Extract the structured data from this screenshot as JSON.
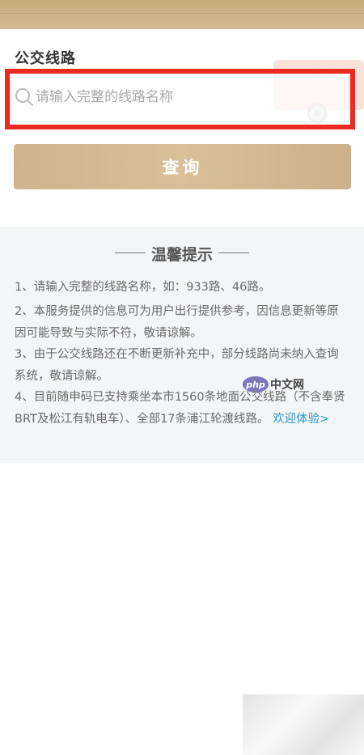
{
  "section": {
    "title": "公交线路"
  },
  "search": {
    "placeholder": "请输入完整的线路名称",
    "value": ""
  },
  "query_button": {
    "label": "查询"
  },
  "tips": {
    "heading": "温馨提示",
    "items": [
      "1、请输入完整的线路名称，如：933路、46路。",
      "2、本服务提供的信息可为用户出行提供参考，因信息更新等原因可能导致与实际不符，敬请谅解。",
      "3、由于公交线路还在不断更新补充中，部分线路尚未纳入查询系统，敬请谅解。",
      "4、目前随申码已支持乘坐本市1560条地面公交线路（不含奉贤BRT及松江有轨电车）、全部17条浦江轮渡线路。"
    ],
    "link": "欢迎体验>"
  },
  "watermark": {
    "logo": "php",
    "text": "中文网"
  },
  "colors": {
    "accent": "#d3b98f",
    "highlight": "#ea2b22",
    "link": "#2a95c9"
  },
  "icons": {
    "search": "search-icon",
    "bus": "bus-illustration"
  }
}
